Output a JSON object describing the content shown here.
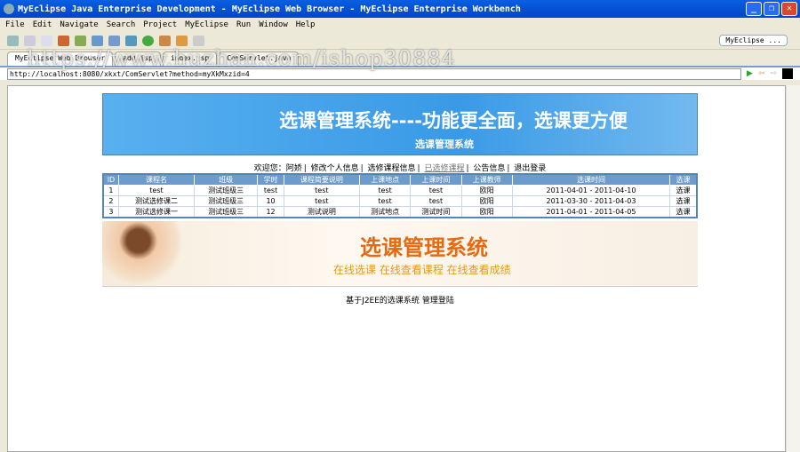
{
  "window": {
    "title": "MyEclipse Java Enterprise Development - MyEclipse Web Browser - MyEclipse Enterprise Workbench",
    "min": "_",
    "max": "❐",
    "close": "✕"
  },
  "menu": [
    "File",
    "Edit",
    "Navigate",
    "Search",
    "Project",
    "MyEclipse",
    "Run",
    "Window",
    "Help"
  ],
  "perspective": "MyEclipse ...",
  "tabs": [
    "MyEclipse Web Browser",
    "add.jsp",
    "index.jsp",
    "ComServlet.java"
  ],
  "watermark": "https://www.huzhan.com/ishop30884",
  "address": "http://localhost:8080/xkxt/ComServlet?method=myXkMxzid=4",
  "banner": {
    "title": "选课管理系统----功能更全面，选课更方便",
    "subtitle": "选课管理系统"
  },
  "nav": {
    "welcome": "欢迎您：阿娇",
    "items": [
      "修改个人信息",
      "选修课程信息",
      "已选修课程",
      "公告信息",
      "退出登录"
    ]
  },
  "table": {
    "headers": [
      "ID",
      "课程名",
      "班级",
      "学时",
      "课程简要说明",
      "上课地点",
      "上课时间",
      "上课教师",
      "选课时间",
      "选课"
    ],
    "rows": [
      [
        "1",
        "test",
        "测试班级三",
        "test",
        "test",
        "test",
        "test",
        "欧阳",
        "2011-04-01 - 2011-04-10",
        "选课"
      ],
      [
        "2",
        "测试选修课二",
        "测试班级三",
        "10",
        "test",
        "test",
        "test",
        "欧阳",
        "2011-03-30 - 2011-04-03",
        "选课"
      ],
      [
        "3",
        "测试选修课一",
        "测试班级三",
        "12",
        "测试说明",
        "测试地点",
        "测试时间",
        "欧阳",
        "2011-04-01 - 2011-04-05",
        "选课"
      ]
    ]
  },
  "ad": {
    "title": "选课管理系统",
    "slogan": "在线选课 在线查看课程 在线查看成绩"
  },
  "footer": {
    "text": "基于J2EE的选课系统",
    "admin": "管理登陆"
  }
}
